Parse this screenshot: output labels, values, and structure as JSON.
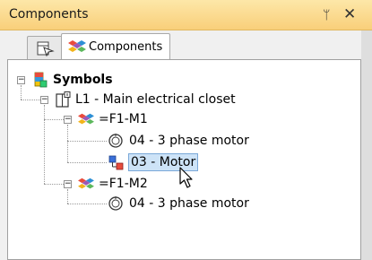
{
  "panel": {
    "title": "Components",
    "pin_glyph": "ᛘ",
    "close_glyph": "✕"
  },
  "tabs": [
    {
      "label": "",
      "icon": "navigator-icon"
    },
    {
      "label": "Components",
      "icon": "components-cube-icon"
    }
  ],
  "tree": {
    "root": {
      "label": "Symbols",
      "icon": "symbols-icon",
      "expanded": true
    },
    "location": {
      "label": "L1 - Main electrical closet",
      "icon": "cabinet-icon",
      "expanded": true
    },
    "groups": [
      {
        "label": "=F1-M1",
        "icon": "component-cube-icon",
        "expanded": true,
        "children": [
          {
            "label": "04 - 3 phase motor",
            "icon": "motor-symbol-icon",
            "selected": false
          },
          {
            "label": "03 - Motor",
            "icon": "schematic-symbol-icon",
            "selected": true
          }
        ]
      },
      {
        "label": "=F1-M2",
        "icon": "component-cube-icon",
        "expanded": true,
        "children": [
          {
            "label": "04 - 3 phase motor",
            "icon": "motor-symbol-icon",
            "selected": false
          }
        ]
      }
    ]
  },
  "colors": {
    "title_bar": "#fbd98e",
    "selection": "#cde3f7"
  }
}
